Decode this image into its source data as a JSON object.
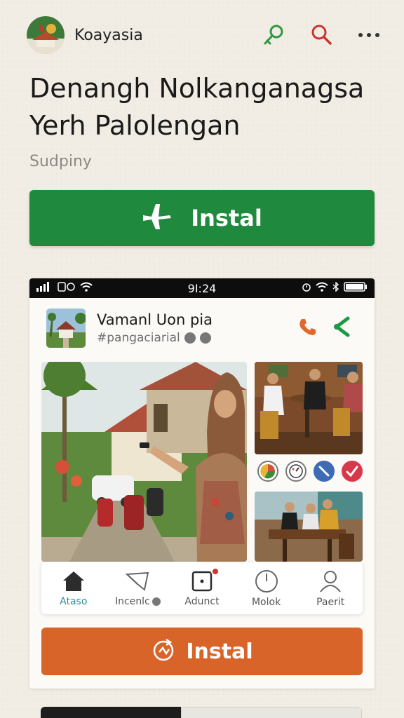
{
  "header": {
    "app_name": "Koayasia",
    "icons": [
      "key-icon",
      "search-icon",
      "more-icon"
    ]
  },
  "title": {
    "line1": "Denangh Nolkanganagsa",
    "line2": "Yerh Palolengan"
  },
  "subtitle": "Sudpiny",
  "install_button": {
    "label": "Instal",
    "icon": "airplane-icon",
    "color": "#1f8a3e"
  },
  "phone": {
    "status_bar": {
      "time": "9I:24"
    },
    "post": {
      "name": "Vamanl Uon pia",
      "tag": "#pangaciarial",
      "actions": [
        "phone-icon",
        "share-icon"
      ]
    },
    "tabbar": [
      {
        "label": "Ataso",
        "icon": "home-icon",
        "active": true
      },
      {
        "label": "Incenlc",
        "icon": "send-icon",
        "active": false
      },
      {
        "label": "Adunct",
        "icon": "dice-icon",
        "active": false
      },
      {
        "label": "Molok",
        "icon": "clock-icon",
        "active": false
      },
      {
        "label": "Paerit",
        "icon": "user-icon",
        "active": false
      }
    ],
    "install_secondary": {
      "label": "Instal",
      "icon": "refresh-icon",
      "color": "#d9642a"
    }
  }
}
